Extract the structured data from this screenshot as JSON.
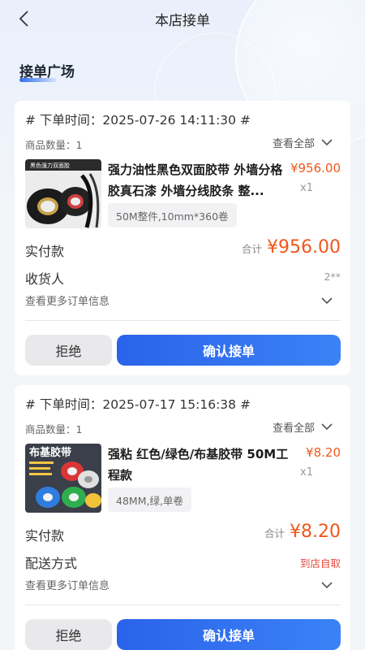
{
  "header": {
    "title": "本店接单"
  },
  "section": {
    "title": "接单广场"
  },
  "orders": [
    {
      "order_time": "# 下单时间：2025-07-26 14:11:30 #",
      "item_count": "商品数量：1",
      "view_all": "查看全部",
      "thumb_caption": "黑色强力双面胶",
      "product_name": "强力油性黑色双面胶带 外墙分格胶真石漆 外墙分线胶条 整...",
      "price": "¥956.00",
      "qty": "x1",
      "spec": "50M整件,10mm*360卷",
      "paid_label": "实付款",
      "total_label": "合计",
      "total_amount": "¥956.00",
      "extra_label": "收货人",
      "extra_value": "2**",
      "more_info": "查看更多订单信息",
      "reject": "拒绝",
      "accept": "确认接单"
    },
    {
      "order_time": "# 下单时间：2025-07-17 15:16:38 #",
      "item_count": "商品数量：1",
      "view_all": "查看全部",
      "thumb_caption": "布基胶带",
      "product_name": "强粘 红色/绿色/布基胶带 50M工程款",
      "price": "¥8.20",
      "qty": "x1",
      "spec": "48MM,绿,单卷",
      "paid_label": "实付款",
      "total_label": "合计",
      "total_amount": "¥8.20",
      "extra_label": "配送方式",
      "extra_value": "到店自取",
      "more_info": "查看更多订单信息",
      "reject": "拒绝",
      "accept": "确认接单"
    }
  ],
  "colors": {
    "accent": "#2f6df0",
    "price": "#f0571b",
    "pickup": "#e84a3c"
  },
  "icons": {
    "back": "chevron-left-icon",
    "expand": "chevron-down-icon"
  }
}
